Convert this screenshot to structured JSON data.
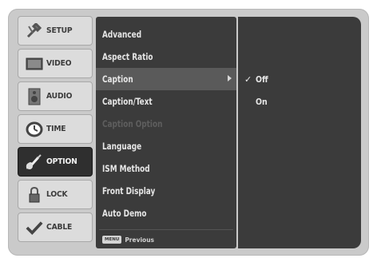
{
  "sidebar": {
    "items": [
      {
        "label": "SETUP",
        "icon": "wrench-icon"
      },
      {
        "label": "VIDEO",
        "icon": "tv-icon"
      },
      {
        "label": "AUDIO",
        "icon": "speaker-icon"
      },
      {
        "label": "TIME",
        "icon": "clock-icon"
      },
      {
        "label": "OPTION",
        "icon": "guitar-icon",
        "active": true
      },
      {
        "label": "LOCK",
        "icon": "padlock-icon"
      },
      {
        "label": "CABLE",
        "icon": "check-plug-icon"
      }
    ]
  },
  "menu": {
    "items": [
      {
        "label": "Advanced"
      },
      {
        "label": "Aspect Ratio"
      },
      {
        "label": "Caption",
        "selected": true
      },
      {
        "label": "Caption/Text"
      },
      {
        "label": "Caption Option",
        "disabled": true
      },
      {
        "label": "Language"
      },
      {
        "label": "ISM Method"
      },
      {
        "label": "Front Display"
      },
      {
        "label": "Auto Demo"
      }
    ],
    "footer": {
      "button": "MENU",
      "label": "Previous"
    }
  },
  "submenu": {
    "items": [
      {
        "label": "Off",
        "checked": true,
        "check": "✓"
      },
      {
        "label": "On",
        "checked": false
      }
    ]
  },
  "colors": {
    "panel": "#3b3b3b",
    "selected_row": "#5a5a5a",
    "frame": "#cacaca",
    "sidebar_active": "#2f2f2f"
  }
}
